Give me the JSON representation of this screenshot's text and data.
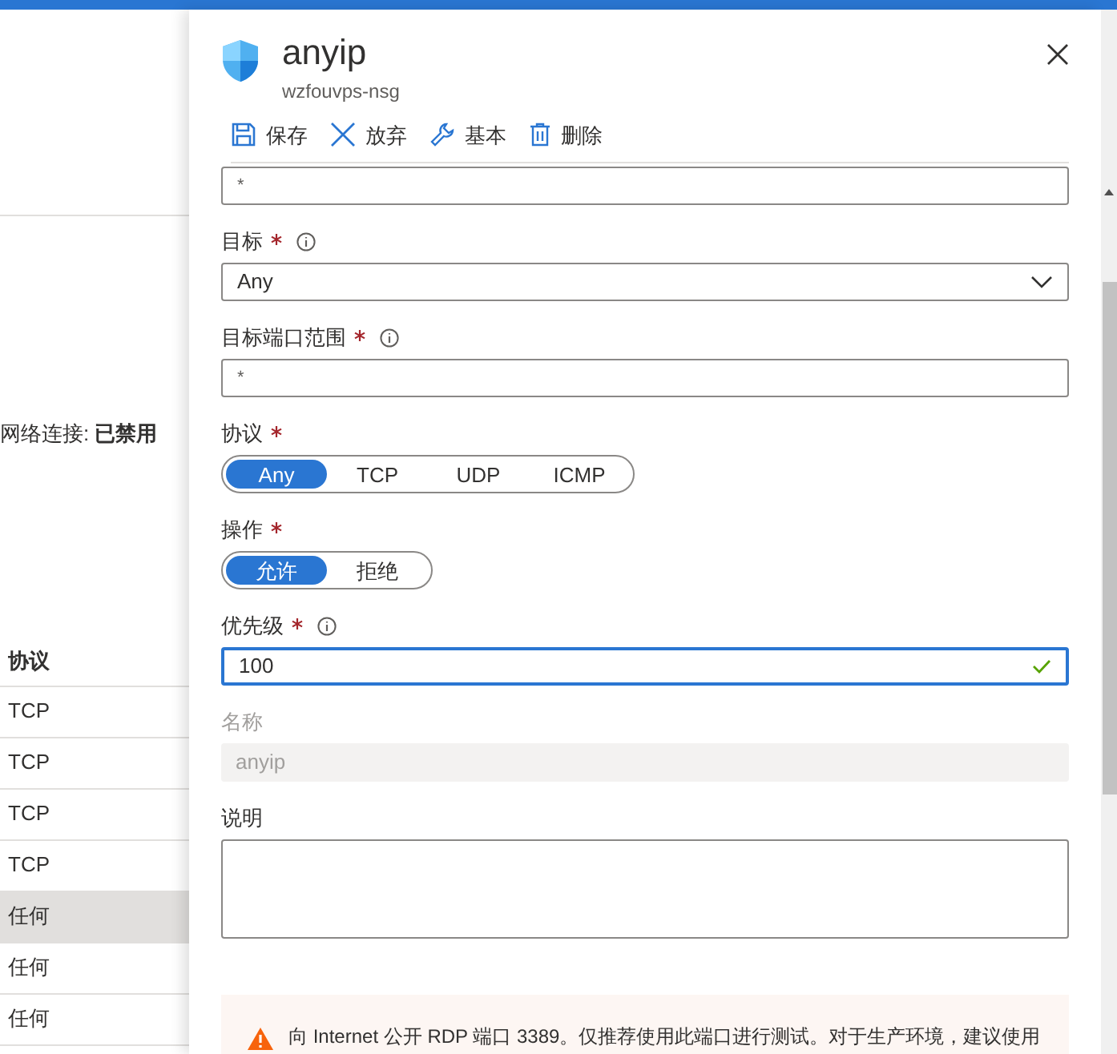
{
  "background_page": {
    "status_text": "网络连接: **已禁用**",
    "table": {
      "columns": [
        "协议"
      ],
      "rows": [
        {
          "cells": [
            "TCP"
          ],
          "selected": false
        },
        {
          "cells": [
            "TCP"
          ],
          "selected": false
        },
        {
          "cells": [
            "TCP"
          ],
          "selected": false
        },
        {
          "cells": [
            "TCP"
          ],
          "selected": false
        },
        {
          "cells": [
            "任何"
          ],
          "selected": true
        },
        {
          "cells": [
            "任何"
          ],
          "selected": false
        },
        {
          "cells": [
            "任何"
          ],
          "selected": false
        }
      ]
    }
  },
  "panel": {
    "title": "anyip",
    "subtitle": "wzfouvps-nsg",
    "toolbar": [
      {
        "label": "保存"
      },
      {
        "label": "放弃"
      },
      {
        "label": "基本"
      },
      {
        "label": "删除"
      }
    ],
    "fields": [
      {
        "kind": "text",
        "value": "*",
        "disabled": false,
        "focused": false,
        "valid": false
      },
      {
        "kind": "dropdown",
        "label": "目标",
        "value": "Any",
        "required": true,
        "info": true
      },
      {
        "kind": "text",
        "label": "目标端口范围",
        "value": "*",
        "required": true,
        "info": true,
        "disabled": false,
        "focused": false,
        "valid": false
      },
      {
        "kind": "segmented",
        "label": "协议",
        "required": true,
        "info": false,
        "options": [
          {
            "label": "Any",
            "selected": true
          },
          {
            "label": "TCP",
            "selected": false
          },
          {
            "label": "UDP",
            "selected": false
          },
          {
            "label": "ICMP",
            "selected": false
          }
        ]
      },
      {
        "kind": "segmented",
        "label": "操作",
        "required": true,
        "info": false,
        "options": [
          {
            "label": "允许",
            "selected": true
          },
          {
            "label": "拒绝",
            "selected": false
          }
        ]
      },
      {
        "kind": "text",
        "label": "优先级",
        "value": "100",
        "required": true,
        "info": true,
        "disabled": false,
        "focused": true,
        "valid": true
      },
      {
        "kind": "text",
        "label": "名称",
        "value": "anyip",
        "required": false,
        "info": false,
        "disabled": true,
        "focused": false,
        "valid": false
      },
      {
        "kind": "textarea",
        "label": "说明",
        "required": false,
        "info": false
      }
    ],
    "warning": "向 Internet 公开 RDP 端口 3389。仅推荐使用此端口进行测试。对于生产环境，建议使用"
  }
}
